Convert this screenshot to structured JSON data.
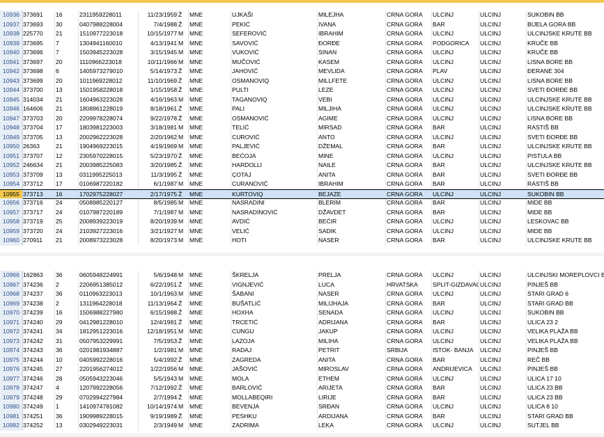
{
  "block1": [
    {
      "n": "10936",
      "id": "373691",
      "age": "16",
      "jmbg": "2311959228011",
      "date": "11/23/1959",
      "sex": "Ž",
      "nat": "MNE",
      "last": "UJKAŠI",
      "first": "MILEJHA",
      "country": "CRNA GORA",
      "city1": "ULCINJ",
      "city2": "ULCINJ",
      "addr": "SUKOBIN BB"
    },
    {
      "n": "10937",
      "id": "373693",
      "age": "30",
      "jmbg": "0407988228004",
      "date": "7/4/1988",
      "sex": "Ž",
      "nat": "MNE",
      "last": "PEKIĆ",
      "first": "IVANA",
      "country": "CRNA GORA",
      "city1": "BAR",
      "city2": "ULCINJ",
      "addr": "BIJELA GORA BB"
    },
    {
      "n": "10938",
      "id": "225770",
      "age": "21",
      "jmbg": "1510977223018",
      "date": "10/15/1977",
      "sex": "M",
      "nat": "MNE",
      "last": "SEFEROVIĆ",
      "first": "IBRAHIM",
      "country": "CRNA GORA",
      "city1": "ULCINJ",
      "city2": "ULCINJ",
      "addr": "ULCINJSKE KRUTE BB"
    },
    {
      "n": "10939",
      "id": "373695",
      "age": "7",
      "jmbg": "1304941160010",
      "date": "4/13/1941",
      "sex": "M",
      "nat": "MNE",
      "last": "SAVOVIĆ",
      "first": "ĐORĐE",
      "country": "CRNA GORA",
      "city1": "PODGORICA",
      "city2": "ULCINJ",
      "addr": "KRUČE BB"
    },
    {
      "n": "10940",
      "id": "373696",
      "age": "7",
      "jmbg": "1503945223028",
      "date": "3/15/1945",
      "sex": "M",
      "nat": "MNE",
      "last": "VUKOVIĆ",
      "first": "SINAN",
      "country": "CRNA GORA",
      "city1": "ULCINJ",
      "city2": "ULCINJ",
      "addr": "KRUČE BB"
    },
    {
      "n": "10941",
      "id": "373697",
      "age": "20",
      "jmbg": "1110966223018",
      "date": "10/11/1966",
      "sex": "M",
      "nat": "MNE",
      "last": "MUČOVIĆ",
      "first": "KASEM",
      "country": "CRNA GORA",
      "city1": "ULCINJ",
      "city2": "ULCINJ",
      "addr": "LISNA BORE BB"
    },
    {
      "n": "10942",
      "id": "373698",
      "age": "6",
      "jmbg": "1405973279010",
      "date": "5/14/1973",
      "sex": "Ž",
      "nat": "MNE",
      "last": "JAHOVIĆ",
      "first": "MEVLIDA",
      "country": "CRNA GORA",
      "city1": "PLAV",
      "city2": "ULCINJ",
      "addr": "ĐERANE 304"
    },
    {
      "n": "10943",
      "id": "373699",
      "age": "20",
      "jmbg": "1011969228012",
      "date": "11/10/1969",
      "sex": "Ž",
      "nat": "MNE",
      "last": "OSMANOVIQ",
      "first": "MILLFETE",
      "country": "CRNA GORA",
      "city1": "ULCINJ",
      "city2": "ULCINJ",
      "addr": "LISNA BORE BB"
    },
    {
      "n": "10944",
      "id": "373700",
      "age": "13",
      "jmbg": "1501958228018",
      "date": "1/15/1958",
      "sex": "Ž",
      "nat": "MNE",
      "last": "PULTI",
      "first": "LEZE",
      "country": "CRNA GORA",
      "city1": "ULCINJ",
      "city2": "ULCINJ",
      "addr": "SVETI ĐORĐE BB"
    },
    {
      "n": "10945",
      "id": "314034",
      "age": "21",
      "jmbg": "1604963223028",
      "date": "4/16/1963",
      "sex": "M",
      "nat": "MNE",
      "last": "TAGANOVIQ",
      "first": "VEBI",
      "country": "CRNA GORA",
      "city1": "ULCINJ",
      "city2": "ULCINJ",
      "addr": "ULCINJSKE KRUTE BB"
    },
    {
      "n": "10946",
      "id": "164606",
      "age": "21",
      "jmbg": "1808961228019",
      "date": "8/18/1961",
      "sex": "Ž",
      "nat": "MNE",
      "last": "PALI",
      "first": "MILJIHA",
      "country": "CRNA GORA",
      "city1": "ULCINJ",
      "city2": "ULCINJ",
      "addr": "ULCINJSKE KRUTE BB"
    },
    {
      "n": "10947",
      "id": "373703",
      "age": "20",
      "jmbg": "2209978228074",
      "date": "9/22/1978",
      "sex": "Ž",
      "nat": "MNE",
      "last": "OSMANOVIĆ",
      "first": "AGIME",
      "country": "CRNA GORA",
      "city1": "ULCINJ",
      "city2": "ULCINJ",
      "addr": "LISNA BORE BB"
    },
    {
      "n": "10948",
      "id": "373704",
      "age": "17",
      "jmbg": "1803981223003",
      "date": "3/18/1981",
      "sex": "M",
      "nat": "MNE",
      "last": "TELIĆ",
      "first": "MIRSAD",
      "country": "CRNA GORA",
      "city1": "BAR",
      "city2": "ULCINJ",
      "addr": "RASTIŠ BB"
    },
    {
      "n": "10949",
      "id": "373705",
      "age": "13",
      "jmbg": "2002962223028",
      "date": "2/20/1962",
      "sex": "M",
      "nat": "MNE",
      "last": "CUROVIĆ",
      "first": "ANTO",
      "country": "CRNA GORA",
      "city1": "ULCINJ",
      "city2": "ULCINJ",
      "addr": "SVETI ĐORĐE BB"
    },
    {
      "n": "10950",
      "id": "26363",
      "age": "21",
      "jmbg": "1904969223015",
      "date": "4/19/1969",
      "sex": "M",
      "nat": "MNE",
      "last": "PALJEVIĆ",
      "first": "DŽEMAL",
      "country": "CRNA GORA",
      "city1": "BAR",
      "city2": "ULCINJ",
      "addr": "ULCINJSKE KRUTE BB"
    },
    {
      "n": "10951",
      "id": "373707",
      "age": "12",
      "jmbg": "2305970228015",
      "date": "5/23/1970",
      "sex": "Ž",
      "nat": "MNE",
      "last": "BEĆOJA",
      "first": "MINE",
      "country": "CRNA GORA",
      "city1": "ULCINJ",
      "city2": "ULCINJ",
      "addr": "PISTULA BB"
    },
    {
      "n": "10952",
      "id": "246634",
      "age": "21",
      "jmbg": "2003985225083",
      "date": "3/20/1985",
      "sex": "Ž",
      "nat": "MNE",
      "last": "HARDOLLI",
      "first": "NAILE",
      "country": "CRNA GORA",
      "city1": "BAR",
      "city2": "ULCINJ",
      "addr": "ULCINJSKE KRUTE BB"
    },
    {
      "n": "10953",
      "id": "373709",
      "age": "13",
      "jmbg": "0311995225013",
      "date": "11/3/1995",
      "sex": "Ž",
      "nat": "MNE",
      "last": "ÇOTAJ",
      "first": "ANITA",
      "country": "CRNA GORA",
      "city1": "BAR",
      "city2": "ULCINJ",
      "addr": "SVETI ĐORĐE BB"
    },
    {
      "n": "10954",
      "id": "373712",
      "age": "17",
      "jmbg": "0106987220182",
      "date": "6/1/1987",
      "sex": "M",
      "nat": "MNE",
      "last": "CURANOVIĆ",
      "first": "IBRAHIM",
      "country": "CRNA GORA",
      "city1": "BAR",
      "city2": "ULCINJ",
      "addr": "RASTIŠ BB"
    },
    {
      "n": "10955",
      "id": "373713",
      "age": "16",
      "jmbg": "1702975228027",
      "date": "2/17/1975",
      "sex": "Ž",
      "nat": "MNE",
      "last": "KURTOVIQ",
      "first": "BEJAZE",
      "country": "CRNA GORA",
      "city1": "ULCINJ",
      "city2": "ULCINJ",
      "addr": "SUKOBIN BB"
    },
    {
      "n": "10956",
      "id": "373716",
      "age": "24",
      "jmbg": "0508985220127",
      "date": "8/5/1985",
      "sex": "M",
      "nat": "MNE",
      "last": "NASRADINI",
      "first": "BLERIM",
      "country": "CRNA GORA",
      "city1": "BAR",
      "city2": "ULCINJ",
      "addr": "MIDE BB"
    },
    {
      "n": "10957",
      "id": "373717",
      "age": "24",
      "jmbg": "0107987220189",
      "date": "7/1/1987",
      "sex": "M",
      "nat": "MNE",
      "last": "NASRADINOVIĆ",
      "first": "DŽAVDET",
      "country": "CRNA GORA",
      "city1": "BAR",
      "city2": "ULCINJ",
      "addr": "MIDE BB"
    },
    {
      "n": "10958",
      "id": "373719",
      "age": "25",
      "jmbg": "2008939223019",
      "date": "8/20/1939",
      "sex": "M",
      "nat": "MNE",
      "last": "AVDIĆ",
      "first": "BEĆIR",
      "country": "CRNA GORA",
      "city1": "ULCINJ",
      "city2": "ULCINJ",
      "addr": "LESKOVAC BB"
    },
    {
      "n": "10959",
      "id": "373720",
      "age": "24",
      "jmbg": "2103927223016",
      "date": "3/21/1927",
      "sex": "M",
      "nat": "MNE",
      "last": "VELIĆ",
      "first": "SADIK",
      "country": "CRNA GORA",
      "city1": "ULCINJ",
      "city2": "ULCINJ",
      "addr": "MIDE BB"
    },
    {
      "n": "10960",
      "id": "270911",
      "age": "21",
      "jmbg": "2008973223028",
      "date": "8/20/1973",
      "sex": "M",
      "nat": "MNE",
      "last": "HOTI",
      "first": "NASER",
      "country": "CRNA GORA",
      "city1": "BAR",
      "city2": "ULCINJ",
      "addr": "ULCINJSKE KRUTE BB"
    }
  ],
  "block2": [
    {
      "n": "10966",
      "id": "162863",
      "age": "36",
      "jmbg": "0605948224991",
      "date": "5/6/1948",
      "sex": "M",
      "nat": "MNE",
      "last": "ŠKRELJA",
      "first": "PRELJA",
      "country": "CRNA GORA",
      "city1": "ULCINJ",
      "city2": "ULCINJ",
      "addr": "ULCINJSKI MOREPLOVCI BB"
    },
    {
      "n": "10967",
      "id": "374236",
      "age": "2",
      "jmbg": "2206951385012",
      "date": "6/22/1951",
      "sex": "Ž",
      "nat": "MNE",
      "last": "VIGNJEVIĆ",
      "first": "LUCA",
      "country": "HRVATSKA",
      "city1": "SPLIT-GIZDAVAC",
      "city2": "ULCINJ",
      "addr": "PINJEŠ BB"
    },
    {
      "n": "10968",
      "id": "374237",
      "age": "36",
      "jmbg": "0110963223013",
      "date": "10/1/1963",
      "sex": "M",
      "nat": "MNE",
      "last": "ŠABANI",
      "first": "NASER",
      "country": "CRNA GORA",
      "city1": "ULCINJ",
      "city2": "ULCINJ",
      "addr": "STARI GRAD 6"
    },
    {
      "n": "10969",
      "id": "374238",
      "age": "2",
      "jmbg": "1311964228018",
      "date": "11/13/1964",
      "sex": "Ž",
      "nat": "MNE",
      "last": "BUŠATLIĆ",
      "first": "MILIJHAJA",
      "country": "CRNA GORA",
      "city1": "BAR",
      "city2": "ULCINJ",
      "addr": "STARI GRAD BB"
    },
    {
      "n": "10970",
      "id": "374239",
      "age": "16",
      "jmbg": "1506988227980",
      "date": "6/15/1988",
      "sex": "Ž",
      "nat": "MNE",
      "last": "HOXHA",
      "first": "SENADA",
      "country": "CRNA GORA",
      "city1": "ULCINJ",
      "city2": "ULCINJ",
      "addr": "SUKOBIN BB"
    },
    {
      "n": "10971",
      "id": "374240",
      "age": "29",
      "jmbg": "0412981228010",
      "date": "12/4/1981",
      "sex": "Ž",
      "nat": "MNE",
      "last": "TRCETIĆ",
      "first": "ADRIJANA",
      "country": "CRNA GORA",
      "city1": "BAR",
      "city2": "ULCINJ",
      "addr": "ULICA 23 2"
    },
    {
      "n": "10972",
      "id": "374241",
      "age": "34",
      "jmbg": "1812951223016",
      "date": "12/18/1951",
      "sex": "M",
      "nat": "MNE",
      "last": "CUNGU",
      "first": "JAKUP",
      "country": "CRNA GORA",
      "city1": "ULCINJ",
      "city2": "ULCINJ",
      "addr": "VELIKA PLAŽA BB"
    },
    {
      "n": "10973",
      "id": "374242",
      "age": "31",
      "jmbg": "0507953229991",
      "date": "7/5/1953",
      "sex": "Ž",
      "nat": "MNE",
      "last": "LAZOJA",
      "first": "MILIHA",
      "country": "CRNA GORA",
      "city1": "ULCINJ",
      "city2": "ULCINJ",
      "addr": "VELIKA PLAŽA BB"
    },
    {
      "n": "10974",
      "id": "374243",
      "age": "36",
      "jmbg": "0201981934887",
      "date": "1/2/1981",
      "sex": "M",
      "nat": "MNE",
      "last": "RADAJ",
      "first": "PETRIT",
      "country": "SRBIJA",
      "city1": "ISTOK- BANJA",
      "city2": "ULCINJ",
      "addr": "PINJEŠ BB"
    },
    {
      "n": "10975",
      "id": "374244",
      "age": "10",
      "jmbg": "0405992228016",
      "date": "5/4/1992",
      "sex": "Ž",
      "nat": "MNE",
      "last": "ZAGREDA",
      "first": "ANITA",
      "country": "CRNA GORA",
      "city1": "BAR",
      "city2": "ULCINJ",
      "addr": "REČ BB"
    },
    {
      "n": "10976",
      "id": "374245",
      "age": "27",
      "jmbg": "2201956274012",
      "date": "1/22/1956",
      "sex": "M",
      "nat": "MNE",
      "last": "JAŠOVIĆ",
      "first": "MIROSLAV",
      "country": "CRNA GORA",
      "city1": "ANDRIJEVICA",
      "city2": "ULCINJ",
      "addr": "PINJEŠ BB"
    },
    {
      "n": "10977",
      "id": "374246",
      "age": "28",
      "jmbg": "0505943223046",
      "date": "5/5/1943",
      "sex": "M",
      "nat": "MNE",
      "last": "MOLA",
      "first": "ETHEM",
      "country": "CRNA GORA",
      "city1": "ULCINJ",
      "city2": "ULCINJ",
      "addr": "ULICA 17 10"
    },
    {
      "n": "10978",
      "id": "374247",
      "age": "4",
      "jmbg": "1207992228056",
      "date": "7/12/1992",
      "sex": "Ž",
      "nat": "MNE",
      "last": "BARLOVIĆ",
      "first": "ARIJETA",
      "country": "CRNA GORA",
      "city1": "BAR",
      "city2": "ULCINJ",
      "addr": "ULICA 23 BB"
    },
    {
      "n": "10979",
      "id": "374248",
      "age": "29",
      "jmbg": "0702994227984",
      "date": "2/7/1994",
      "sex": "Ž",
      "nat": "MNE",
      "last": "MOLLABEQIRI",
      "first": "LIRIJE",
      "country": "CRNA GORA",
      "city1": "BAR",
      "city2": "ULCINJ",
      "addr": "ULICA 23 BB"
    },
    {
      "n": "10980",
      "id": "374249",
      "age": "1",
      "jmbg": "1410974781082",
      "date": "10/14/1974",
      "sex": "M",
      "nat": "MNE",
      "last": "BEVENJA",
      "first": "SRĐAN",
      "country": "CRNA GORA",
      "city1": "ULCINJ",
      "city2": "ULCINJ",
      "addr": "ULICA 8 10"
    },
    {
      "n": "10981",
      "id": "374251",
      "age": "36",
      "jmbg": "1909989228015",
      "date": "9/19/1989",
      "sex": "Ž",
      "nat": "MNE",
      "last": "PESHKU",
      "first": "ARDIJANA",
      "country": "CRNA GORA",
      "city1": "BAR",
      "city2": "ULCINJ",
      "addr": "STARI GRAD BB"
    },
    {
      "n": "10982",
      "id": "374252",
      "age": "13",
      "jmbg": "0302949223031",
      "date": "2/3/1949",
      "sex": "M",
      "nat": "MNE",
      "last": "ZADRIMA",
      "first": "LEKA",
      "country": "CRNA GORA",
      "city1": "ULCINJ",
      "city2": "ULCINJ",
      "addr": "SUTJEL BB"
    }
  ],
  "selected_row": "10955",
  "colors": {
    "accent": "#f2c84b",
    "selection": "#cfe2f6",
    "rownum_bg": "#e8eef6",
    "rownum_text": "#2b4f8a"
  }
}
